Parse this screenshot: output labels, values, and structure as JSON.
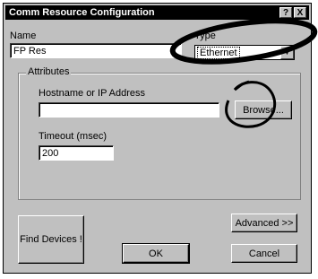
{
  "window": {
    "title": "Comm Resource Configuration",
    "help_button": "?",
    "close_button": "X"
  },
  "name": {
    "label": "Name",
    "value": "FP Res"
  },
  "type": {
    "label": "Type",
    "selected": "Ethernet"
  },
  "attributes": {
    "group_label": "Attributes",
    "hostname_label": "Hostname or IP Address",
    "hostname_value": "",
    "browse_button": "Browse...",
    "timeout_label": "Timeout (msec)",
    "timeout_value": "200"
  },
  "buttons": {
    "find_devices": "Find Devices !",
    "advanced": "Advanced  >>",
    "ok": "OK",
    "cancel": "Cancel"
  },
  "icons": [
    "help-icon",
    "close-icon",
    "dropdown-arrow-icon"
  ]
}
